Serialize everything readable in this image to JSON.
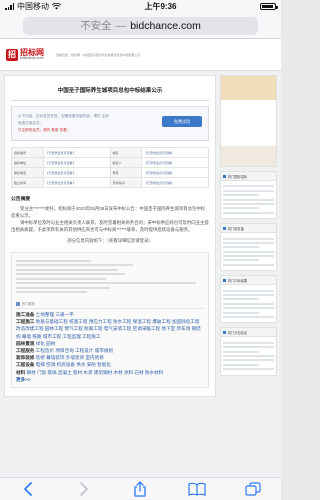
{
  "status_bar": {
    "carrier": "中国移动",
    "time": "上午9:36"
  },
  "url_bar": {
    "insecure": "不安全",
    "separator": "—",
    "domain": "bidchance.com"
  },
  "site": {
    "logo_cn": "招标网",
    "logo_en": "bidchance.com",
    "breadcrumb": "当前位置：招标网 > 中国圣子国际养生城项目总包中标结果公示"
  },
  "article": {
    "title": "中国圣子国际养生城项目总包中标结果公示",
    "notice_lines": [
      "以下内容，仅对会员开放，如需查看详细内容，请先 注册",
      "免费试用会员。",
      "已注册的会员，请先 登录 查看。"
    ],
    "free_button": "免费试用",
    "info_rows": [
      [
        "招标编号",
        "【已登录会员可查看】",
        "地区",
        "【已登录会员可查看】"
      ],
      [
        "招标单位",
        "【已登录会员可查看】",
        "联系人",
        "【已登录会员可查看】"
      ],
      [
        "联系电话",
        "【已登录会员可查看】",
        "传真",
        "【已登录会员可查看】"
      ],
      [
        "截止时间",
        "【已登录会员可查看】",
        "开标时间",
        "【已登录会员可查看】"
      ]
    ],
    "summary_title": "公告摘要",
    "summary_paragraphs": [
      "受业主*******委托，招标网于2020年05月08日发布中标公告：中国圣子国际养生城项目总包中标结果公示。",
      "请中标单位及时与业主相关负责人联系，及时签署相关商务合同；未中标供应商也可及时向业主提出相关质疑，于此项目有关的其他供应商也可与中标商******联系，及时提供后续设备与服务。"
    ],
    "partial_info": "部分信息内容如下：（查看详细信息请登录）",
    "partial_info_link": "登录",
    "hot_head": "热门推荐",
    "services": [
      {
        "label": "施工准备",
        "items": "土地整理 三通一平"
      },
      {
        "label": "工程施工",
        "items": "地基与基础工程 桩基工程 预应力工程 防水工程 保温工程 爆破工程 加固除险工程 改造改建工程 园林工程 燃气工程 防腐工程 电气安装工程 空调采暖工程 地下室 停车场 钢结构 幕墙 铁路 城市工程 工程监理 工程施工"
      },
      {
        "label": "园林景观",
        "items": "绿化 园林"
      },
      {
        "label": "工程服务",
        "items": "工程造价 项目咨询 工程设计 城市规划"
      },
      {
        "label": "装饰装修",
        "items": "装修 幕墙装饰 外墙装饰 室内装修"
      },
      {
        "label": "工程设备",
        "items": "电梯 空调 机房设备 供水 安防 智能化"
      },
      {
        "label": "材料",
        "items": "钢材 门窗 玻璃 混凝土 管材 水泥 建筑钢材 木材 涂料 石材 防水材料"
      }
    ],
    "more_link": "更多>>"
  },
  "sidebar": {
    "cards": [
      "热门国际招标",
      "热门拟在建",
      "热门中标结果",
      "热门分包信息"
    ]
  }
}
